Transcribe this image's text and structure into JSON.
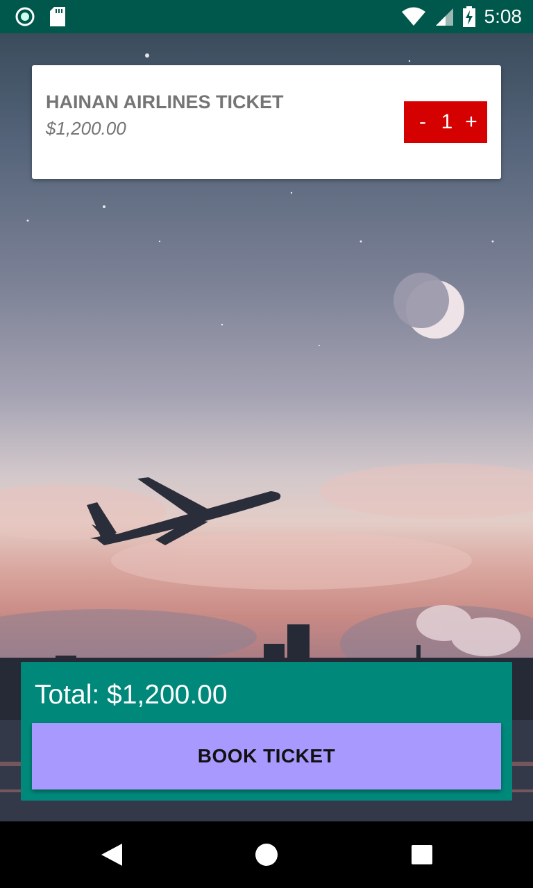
{
  "status_bar": {
    "time": "5:08",
    "icons": [
      "camera-dot-icon",
      "sd-card-icon",
      "wifi-icon",
      "signal-icon",
      "battery-charging-icon"
    ]
  },
  "ticket": {
    "title": "HAINAN AIRLINES TICKET",
    "price": "$1,200.00",
    "stepper": {
      "minus": "-",
      "quantity": "1",
      "plus": "+"
    }
  },
  "summary": {
    "total": "Total: $1,200.00",
    "book_label": "BOOK TICKET"
  },
  "nav_bar": {
    "icons": [
      "back-icon",
      "home-icon",
      "recents-icon"
    ]
  },
  "colors": {
    "status_bar": "#00574b",
    "panel": "#00897b",
    "button": "#a899ff",
    "stepper": "#d50000"
  }
}
